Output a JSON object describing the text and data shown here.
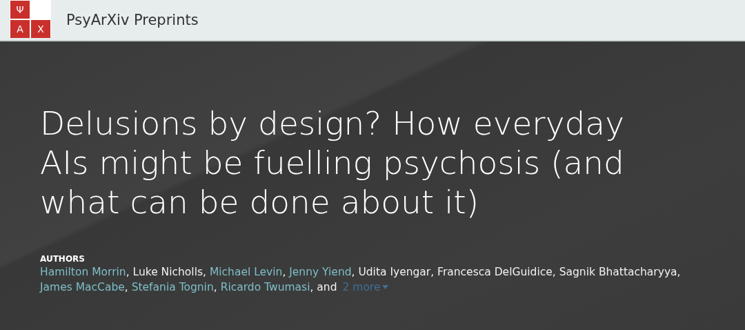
{
  "header": {
    "logo_letters": [
      "Ψ",
      "A",
      "X"
    ],
    "brand": "PsyArXiv Preprints"
  },
  "title": "Delusions by design? How everyday AIs might be fuelling psychosis (and what can be done about it)",
  "authors_label": "AUTHORS",
  "authors": [
    {
      "name": "Hamilton Morrin",
      "linked": true
    },
    {
      "name": "Luke Nicholls",
      "linked": false
    },
    {
      "name": "Michael Levin",
      "linked": true
    },
    {
      "name": "Jenny Yiend",
      "linked": true
    },
    {
      "name": "Udita Iyengar",
      "linked": false
    },
    {
      "name": "Francesca DelGuidice",
      "linked": false
    },
    {
      "name": "Sagnik Bhattacharyya",
      "linked": false
    },
    {
      "name": "James MacCabe",
      "linked": true
    },
    {
      "name": "Stefania Tognin",
      "linked": true
    },
    {
      "name": "Ricardo Twumasi",
      "linked": true
    }
  ],
  "separator": ",",
  "and_text": "and",
  "more_button": "2 more"
}
